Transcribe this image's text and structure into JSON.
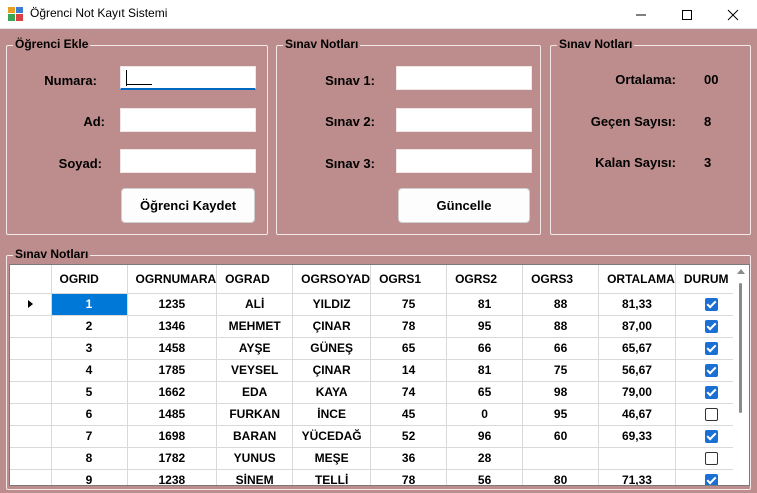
{
  "window": {
    "title": "Öğrenci Not Kayıt Sistemi"
  },
  "ogrenci_ekle": {
    "group_title": "Öğrenci Ekle",
    "numara_label": "Numara:",
    "numara_value": "",
    "ad_label": "Ad:",
    "ad_value": "",
    "soyad_label": "Soyad:",
    "soyad_value": "",
    "kaydet_label": "Öğrenci Kaydet"
  },
  "sinav_notlari_input": {
    "group_title": "Sınav Notları",
    "sinav1_label": "Sınav 1:",
    "sinav1_value": "",
    "sinav2_label": "Sınav 2:",
    "sinav2_value": "",
    "sinav3_label": "Sınav 3:",
    "sinav3_value": "",
    "guncelle_label": "Güncelle"
  },
  "istatistik": {
    "group_title": "Sınav Notları",
    "ortalama_label": "Ortalama:",
    "ortalama_value": "00",
    "gecen_label": "Geçen Sayısı:",
    "gecen_value": "8",
    "kalan_label": "Kalan Sayısı:",
    "kalan_value": "3"
  },
  "grid": {
    "group_title": "Sınav Notları",
    "columns": [
      "OGRID",
      "OGRNUMARA",
      "OGRAD",
      "OGRSOYAD",
      "OGRS1",
      "OGRS2",
      "OGRS3",
      "ORTALAMA",
      "DURUM"
    ],
    "rows": [
      {
        "id": "1",
        "numara": "1235",
        "ad": "ALİ",
        "soyad": "YILDIZ",
        "s1": "75",
        "s2": "81",
        "s3": "88",
        "ort": "81,33",
        "durum": true
      },
      {
        "id": "2",
        "numara": "1346",
        "ad": "MEHMET",
        "soyad": "ÇINAR",
        "s1": "78",
        "s2": "95",
        "s3": "88",
        "ort": "87,00",
        "durum": true
      },
      {
        "id": "3",
        "numara": "1458",
        "ad": "AYŞE",
        "soyad": "GÜNEŞ",
        "s1": "65",
        "s2": "66",
        "s3": "66",
        "ort": "65,67",
        "durum": true
      },
      {
        "id": "4",
        "numara": "1785",
        "ad": "VEYSEL",
        "soyad": "ÇINAR",
        "s1": "14",
        "s2": "81",
        "s3": "75",
        "ort": "56,67",
        "durum": true
      },
      {
        "id": "5",
        "numara": "1662",
        "ad": "EDA",
        "soyad": "KAYA",
        "s1": "74",
        "s2": "65",
        "s3": "98",
        "ort": "79,00",
        "durum": true
      },
      {
        "id": "6",
        "numara": "1485",
        "ad": "FURKAN",
        "soyad": "İNCE",
        "s1": "45",
        "s2": "0",
        "s3": "95",
        "ort": "46,67",
        "durum": false
      },
      {
        "id": "7",
        "numara": "1698",
        "ad": "BARAN",
        "soyad": "YÜCEDAĞ",
        "s1": "52",
        "s2": "96",
        "s3": "60",
        "ort": "69,33",
        "durum": true
      },
      {
        "id": "8",
        "numara": "1782",
        "ad": "YUNUS",
        "soyad": "MEŞE",
        "s1": "36",
        "s2": "28",
        "s3": "",
        "ort": "",
        "durum": false
      },
      {
        "id": "9",
        "numara": "1238",
        "ad": "SİNEM",
        "soyad": "TELLİ",
        "s1": "78",
        "s2": "56",
        "s3": "80",
        "ort": "71,33",
        "durum": true
      }
    ]
  },
  "colors": {
    "form_background": "#bd8c8c",
    "selection": "#0078d7",
    "checkbox_checked": "#1a6fd4"
  },
  "icons": [
    "app-icon",
    "minimize-icon",
    "maximize-icon",
    "close-icon",
    "row-selector-arrow-icon",
    "checkbox-icon"
  ]
}
